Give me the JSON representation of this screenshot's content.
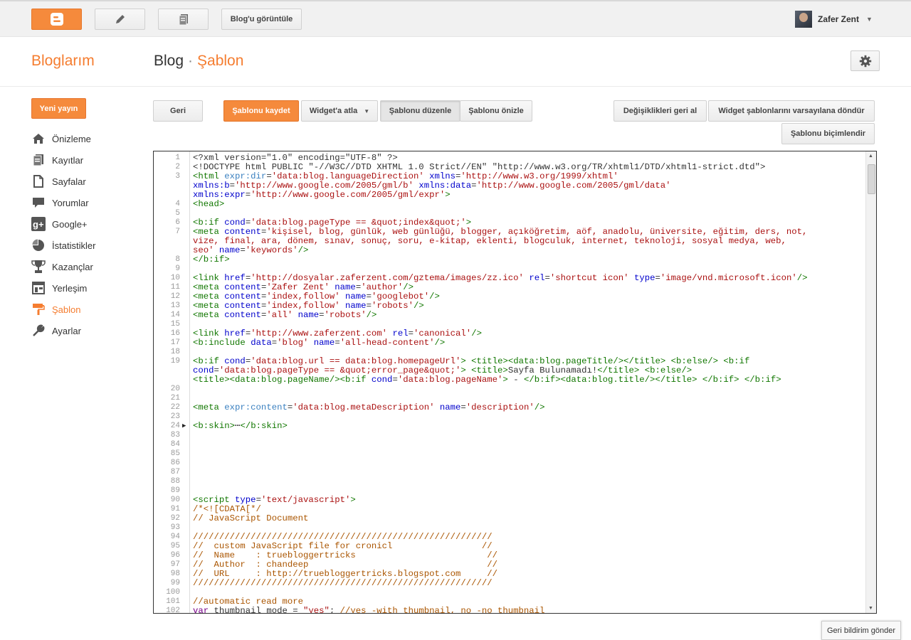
{
  "topbar": {
    "view_blog_label": "Blog'u görüntüle",
    "user_name": "Zafer Zent"
  },
  "header": {
    "my_blogs": "Bloglarım",
    "breadcrumb_blog": "Blog",
    "breadcrumb_sep": "·",
    "breadcrumb_current": "Şablon"
  },
  "sidebar": {
    "new_post": "Yeni yayın",
    "items": [
      {
        "label": "Önizleme",
        "icon": "home-icon"
      },
      {
        "label": "Kayıtlar",
        "icon": "posts-icon"
      },
      {
        "label": "Sayfalar",
        "icon": "pages-icon"
      },
      {
        "label": "Yorumlar",
        "icon": "comments-icon"
      },
      {
        "label": "Google+",
        "icon": "google-plus-icon"
      },
      {
        "label": "İstatistikler",
        "icon": "stats-icon"
      },
      {
        "label": "Kazançlar",
        "icon": "trophy-icon"
      },
      {
        "label": "Yerleşim",
        "icon": "layout-icon"
      },
      {
        "label": "Şablon",
        "icon": "template-icon"
      },
      {
        "label": "Ayarlar",
        "icon": "wrench-icon"
      }
    ]
  },
  "toolbar": {
    "back": "Geri",
    "save_template": "Şablonu kaydet",
    "jump_to_widget": "Widget'a atla",
    "edit_template": "Şablonu düzenle",
    "preview_template": "Şablonu önizle",
    "revert_changes": "Değişiklikleri geri al",
    "revert_widgets": "Widget şablonlarını varsayılana döndür",
    "format_template": "Şablonu biçimlendir"
  },
  "feedback_label": "Geri bildirim gönder",
  "colors": {
    "accent": "#f57d30",
    "tag": "#117700",
    "attr": "#0000cc",
    "string": "#aa1111",
    "comment": "#aa5500"
  },
  "editor": {
    "lines": [
      {
        "n": "1",
        "segs": [
          [
            "x",
            "<?xml version=\"1.0\" encoding=\"UTF-8\" ?>"
          ]
        ]
      },
      {
        "n": "2",
        "segs": [
          [
            "x",
            "<!DOCTYPE html PUBLIC \"-//W3C//DTD XHTML 1.0 Strict//EN\" \"http://www.w3.org/TR/xhtml1/DTD/xhtml1-strict.dtd\">"
          ]
        ]
      },
      {
        "n": "3",
        "segs": [
          [
            "t",
            "<html "
          ],
          [
            "e",
            "expr:dir"
          ],
          [
            "x",
            "="
          ],
          [
            "s",
            "'data:blog.languageDirection'"
          ],
          [
            "x",
            " "
          ],
          [
            "a",
            "xmlns"
          ],
          [
            "x",
            "="
          ],
          [
            "s",
            "'http://www.w3.org/1999/xhtml'"
          ]
        ]
      },
      {
        "n": "",
        "segs": [
          [
            "a",
            "xmlns:b"
          ],
          [
            "x",
            "="
          ],
          [
            "s",
            "'http://www.google.com/2005/gml/b'"
          ],
          [
            "x",
            " "
          ],
          [
            "a",
            "xmlns:data"
          ],
          [
            "x",
            "="
          ],
          [
            "s",
            "'http://www.google.com/2005/gml/data'"
          ]
        ]
      },
      {
        "n": "",
        "segs": [
          [
            "a",
            "xmlns:expr"
          ],
          [
            "x",
            "="
          ],
          [
            "s",
            "'http://www.google.com/2005/gml/expr'"
          ],
          [
            "t",
            ">"
          ]
        ]
      },
      {
        "n": "4",
        "segs": [
          [
            "t",
            "<head>"
          ]
        ]
      },
      {
        "n": "5",
        "segs": []
      },
      {
        "n": "6",
        "segs": [
          [
            "t",
            "<b:if "
          ],
          [
            "a",
            "cond"
          ],
          [
            "x",
            "="
          ],
          [
            "s",
            "'data:blog.pageType == &quot;index&quot;'"
          ],
          [
            "t",
            ">"
          ]
        ]
      },
      {
        "n": "7",
        "segs": [
          [
            "t",
            "<meta "
          ],
          [
            "a",
            "content"
          ],
          [
            "x",
            "="
          ],
          [
            "s",
            "'kişisel, blog, günlük, web günlüğü, blogger, açıköğretim, aöf, anadolu, üniversite, eğitim, ders, not,"
          ]
        ]
      },
      {
        "n": "",
        "segs": [
          [
            "s",
            "vize, final, ara, dönem, sınav, sonuç, soru, e-kitap, eklenti, blogculuk, internet, teknoloji, sosyal medya, web,"
          ]
        ]
      },
      {
        "n": "",
        "segs": [
          [
            "s",
            "seo'"
          ],
          [
            "x",
            " "
          ],
          [
            "a",
            "name"
          ],
          [
            "x",
            "="
          ],
          [
            "s",
            "'keywords'"
          ],
          [
            "t",
            "/>"
          ]
        ]
      },
      {
        "n": "8",
        "segs": [
          [
            "t",
            "</b:if>"
          ]
        ]
      },
      {
        "n": "9",
        "segs": []
      },
      {
        "n": "10",
        "segs": [
          [
            "t",
            "<link "
          ],
          [
            "a",
            "href"
          ],
          [
            "x",
            "="
          ],
          [
            "s",
            "'http://dosyalar.zaferzent.com/gztema/images/zz.ico'"
          ],
          [
            "x",
            " "
          ],
          [
            "a",
            "rel"
          ],
          [
            "x",
            "="
          ],
          [
            "s",
            "'shortcut icon'"
          ],
          [
            "x",
            " "
          ],
          [
            "a",
            "type"
          ],
          [
            "x",
            "="
          ],
          [
            "s",
            "'image/vnd.microsoft.icon'"
          ],
          [
            "t",
            "/>"
          ]
        ]
      },
      {
        "n": "11",
        "segs": [
          [
            "t",
            "<meta "
          ],
          [
            "a",
            "content"
          ],
          [
            "x",
            "="
          ],
          [
            "s",
            "'Zafer Zent'"
          ],
          [
            "x",
            " "
          ],
          [
            "a",
            "name"
          ],
          [
            "x",
            "="
          ],
          [
            "s",
            "'author'"
          ],
          [
            "t",
            "/>"
          ]
        ]
      },
      {
        "n": "12",
        "segs": [
          [
            "t",
            "<meta "
          ],
          [
            "a",
            "content"
          ],
          [
            "x",
            "="
          ],
          [
            "s",
            "'index,follow'"
          ],
          [
            "x",
            " "
          ],
          [
            "a",
            "name"
          ],
          [
            "x",
            "="
          ],
          [
            "s",
            "'googlebot'"
          ],
          [
            "t",
            "/>"
          ]
        ]
      },
      {
        "n": "13",
        "segs": [
          [
            "t",
            "<meta "
          ],
          [
            "a",
            "content"
          ],
          [
            "x",
            "="
          ],
          [
            "s",
            "'index,follow'"
          ],
          [
            "x",
            " "
          ],
          [
            "a",
            "name"
          ],
          [
            "x",
            "="
          ],
          [
            "s",
            "'robots'"
          ],
          [
            "t",
            "/>"
          ]
        ]
      },
      {
        "n": "14",
        "segs": [
          [
            "t",
            "<meta "
          ],
          [
            "a",
            "content"
          ],
          [
            "x",
            "="
          ],
          [
            "s",
            "'all'"
          ],
          [
            "x",
            " "
          ],
          [
            "a",
            "name"
          ],
          [
            "x",
            "="
          ],
          [
            "s",
            "'robots'"
          ],
          [
            "t",
            "/>"
          ]
        ]
      },
      {
        "n": "15",
        "segs": []
      },
      {
        "n": "16",
        "segs": [
          [
            "t",
            "<link "
          ],
          [
            "a",
            "href"
          ],
          [
            "x",
            "="
          ],
          [
            "s",
            "'http://www.zaferzent.com'"
          ],
          [
            "x",
            " "
          ],
          [
            "a",
            "rel"
          ],
          [
            "x",
            "="
          ],
          [
            "s",
            "'canonical'"
          ],
          [
            "t",
            "/>"
          ]
        ]
      },
      {
        "n": "17",
        "segs": [
          [
            "t",
            "<b:include "
          ],
          [
            "a",
            "data"
          ],
          [
            "x",
            "="
          ],
          [
            "s",
            "'blog'"
          ],
          [
            "x",
            " "
          ],
          [
            "a",
            "name"
          ],
          [
            "x",
            "="
          ],
          [
            "s",
            "'all-head-content'"
          ],
          [
            "t",
            "/>"
          ]
        ]
      },
      {
        "n": "18",
        "segs": []
      },
      {
        "n": "19",
        "segs": [
          [
            "t",
            "<b:if "
          ],
          [
            "a",
            "cond"
          ],
          [
            "x",
            "="
          ],
          [
            "s",
            "'data:blog.url == data:blog.homepageUrl'"
          ],
          [
            "t",
            ">"
          ],
          [
            "x",
            " "
          ],
          [
            "t",
            "<title><data:blog.pageTitle/></title>"
          ],
          [
            "x",
            " "
          ],
          [
            "t",
            "<b:else/>"
          ],
          [
            "x",
            " "
          ],
          [
            "t",
            "<b:if"
          ]
        ]
      },
      {
        "n": "",
        "segs": [
          [
            "a",
            "cond"
          ],
          [
            "x",
            "="
          ],
          [
            "s",
            "'data:blog.pageType == &quot;error_page&quot;'"
          ],
          [
            "t",
            ">"
          ],
          [
            "x",
            " "
          ],
          [
            "t",
            "<title>"
          ],
          [
            "x",
            "Sayfa Bulunamadı!"
          ],
          [
            "t",
            "</title>"
          ],
          [
            "x",
            " "
          ],
          [
            "t",
            "<b:else/>"
          ]
        ]
      },
      {
        "n": "",
        "segs": [
          [
            "t",
            "<title><data:blog.pageName/><b:if "
          ],
          [
            "a",
            "cond"
          ],
          [
            "x",
            "="
          ],
          [
            "s",
            "'data:blog.pageName'"
          ],
          [
            "t",
            ">"
          ],
          [
            "x",
            " - "
          ],
          [
            "t",
            "</b:if><data:blog.title/></title>"
          ],
          [
            "x",
            " "
          ],
          [
            "t",
            "</b:if>"
          ],
          [
            "x",
            " "
          ],
          [
            "t",
            "</b:if>"
          ]
        ]
      },
      {
        "n": "20",
        "segs": []
      },
      {
        "n": "21",
        "segs": []
      },
      {
        "n": "22",
        "segs": [
          [
            "t",
            "<meta "
          ],
          [
            "e",
            "expr:content"
          ],
          [
            "x",
            "="
          ],
          [
            "s",
            "'data:blog.metaDescription'"
          ],
          [
            "x",
            " "
          ],
          [
            "a",
            "name"
          ],
          [
            "x",
            "="
          ],
          [
            "s",
            "'description'"
          ],
          [
            "t",
            "/>"
          ]
        ]
      },
      {
        "n": "23",
        "segs": []
      },
      {
        "n": "24",
        "fold": true,
        "segs": [
          [
            "t",
            "<b:skin>"
          ],
          [
            "x",
            "⋯"
          ],
          [
            "t",
            "</b:skin>"
          ]
        ]
      },
      {
        "n": "83",
        "segs": []
      },
      {
        "n": "84",
        "segs": []
      },
      {
        "n": "85",
        "segs": []
      },
      {
        "n": "86",
        "segs": []
      },
      {
        "n": "87",
        "segs": []
      },
      {
        "n": "88",
        "segs": []
      },
      {
        "n": "89",
        "segs": []
      },
      {
        "n": "90",
        "segs": [
          [
            "t",
            "<script "
          ],
          [
            "a",
            "type"
          ],
          [
            "x",
            "="
          ],
          [
            "s",
            "'text/javascript'"
          ],
          [
            "t",
            ">"
          ]
        ]
      },
      {
        "n": "91",
        "segs": [
          [
            "c",
            "/*<![CDATA[*/"
          ]
        ]
      },
      {
        "n": "92",
        "segs": [
          [
            "c",
            "// JavaScript Document"
          ]
        ]
      },
      {
        "n": "93",
        "segs": []
      },
      {
        "n": "94",
        "segs": [
          [
            "c",
            "/////////////////////////////////////////////////////////"
          ]
        ]
      },
      {
        "n": "95",
        "segs": [
          [
            "c",
            "//  custom JavaScript file for cronicl                 //"
          ]
        ]
      },
      {
        "n": "96",
        "segs": [
          [
            "c",
            "//  Name    : truebloggertricks                         //"
          ]
        ]
      },
      {
        "n": "97",
        "segs": [
          [
            "c",
            "//  Author  : chandeep                                  //"
          ]
        ]
      },
      {
        "n": "98",
        "segs": [
          [
            "c",
            "//  URL     : http://truebloggertricks.blogspot.com     //"
          ]
        ]
      },
      {
        "n": "99",
        "segs": [
          [
            "c",
            "/////////////////////////////////////////////////////////"
          ]
        ]
      },
      {
        "n": "100",
        "segs": []
      },
      {
        "n": "101",
        "segs": [
          [
            "c",
            "//automatic read more"
          ]
        ]
      },
      {
        "n": "102",
        "segs": [
          [
            "k",
            "var"
          ],
          [
            "x",
            " thumbnail_mode = "
          ],
          [
            "str",
            "\"yes\""
          ],
          [
            "x",
            "; "
          ],
          [
            "c",
            "//yes -with thumbnail, no -no thumbnail"
          ]
        ]
      }
    ]
  }
}
